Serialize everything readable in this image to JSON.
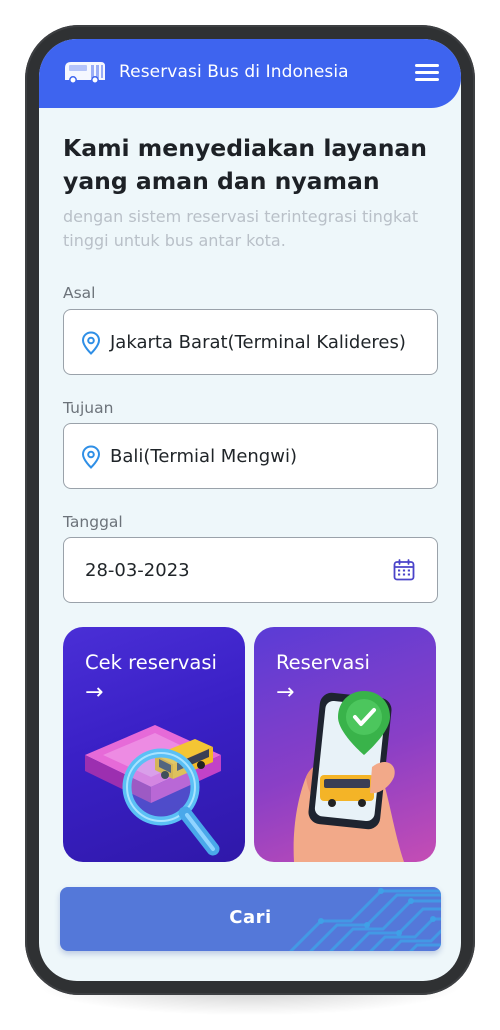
{
  "appbar": {
    "title": "Reservasi Bus di Indonesia",
    "logo_icon": "bus-logo-icon",
    "menu_icon": "hamburger-menu-icon",
    "color": "#3e64ef"
  },
  "hero": {
    "headline": "Kami menyediakan layanan yang aman dan nyaman",
    "subline": "dengan sistem reservasi terintegrasi tingkat tinggi untuk bus antar kota."
  },
  "form": {
    "origin": {
      "label": "Asal",
      "value": "Jakarta Barat(Terminal Kalideres)",
      "icon": "location-pin-icon"
    },
    "destination": {
      "label": "Tujuan",
      "value": "Bali(Termial Mengwi)",
      "icon": "location-pin-icon"
    },
    "date": {
      "label": "Tanggal",
      "value": "28-03-2023",
      "icon": "calendar-icon"
    }
  },
  "cards": [
    {
      "title": "Cek reservasi",
      "arrow": "→",
      "illustration": "bus-ticket-magnifier-illustration"
    },
    {
      "title": "Reservasi",
      "arrow": "→",
      "illustration": "phone-map-pin-bus-illustration"
    }
  ],
  "search_button": {
    "label": "Cari",
    "color": "#5478d9"
  },
  "colors": {
    "screen_bg": "#eef7fa",
    "pin": "#2f8fe6",
    "calendar": "#4a43c9"
  }
}
